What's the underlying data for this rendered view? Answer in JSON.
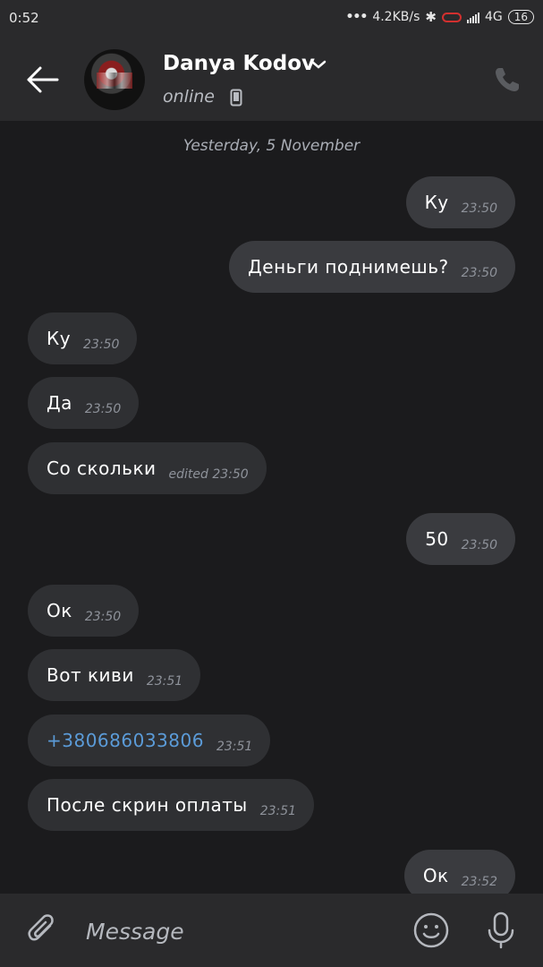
{
  "status_bar": {
    "time": "0:52",
    "network_speed": "4.2KB/s",
    "network_type": "4G",
    "battery": "16",
    "icons": [
      "dots-icon",
      "bluetooth-icon",
      "recording-icon",
      "signal-icon",
      "battery-icon"
    ]
  },
  "header": {
    "contact_name": "Danya Kodov",
    "status": "online",
    "icons": [
      "back-arrow-icon",
      "chevron-down-icon",
      "mobile-phone-icon",
      "call-icon"
    ]
  },
  "chat": {
    "date_separator": "Yesterday, 5 November",
    "messages": [
      {
        "direction": "out",
        "text": "Ку",
        "time": "23:50"
      },
      {
        "direction": "out",
        "text": "Деньги поднимешь?",
        "time": "23:50"
      },
      {
        "direction": "in",
        "text": "Ку",
        "time": "23:50"
      },
      {
        "direction": "in",
        "text": "Да",
        "time": "23:50"
      },
      {
        "direction": "in",
        "text": "Со скольки",
        "time": "edited 23:50"
      },
      {
        "direction": "out",
        "text": "50",
        "time": "23:50"
      },
      {
        "direction": "in",
        "text": "Ок",
        "time": "23:50"
      },
      {
        "direction": "in",
        "text": "Вот киви",
        "time": "23:51"
      },
      {
        "direction": "in",
        "text": "+380686033806",
        "time": "23:51",
        "is_link": true
      },
      {
        "direction": "in",
        "text": "После скрин оплаты",
        "time": "23:51"
      },
      {
        "direction": "out",
        "text": "Ок",
        "time": "23:52"
      }
    ]
  },
  "input_bar": {
    "placeholder": "Message",
    "icons": [
      "paperclip-icon",
      "emoji-icon",
      "microphone-icon"
    ]
  },
  "colors": {
    "background": "#1b1b1d",
    "bar": "#2a2a2c",
    "incoming_bubble": "#2f3033",
    "outgoing_bubble": "#3a3b3f",
    "link": "#5b9bd8",
    "timestamp": "#8e929a"
  }
}
